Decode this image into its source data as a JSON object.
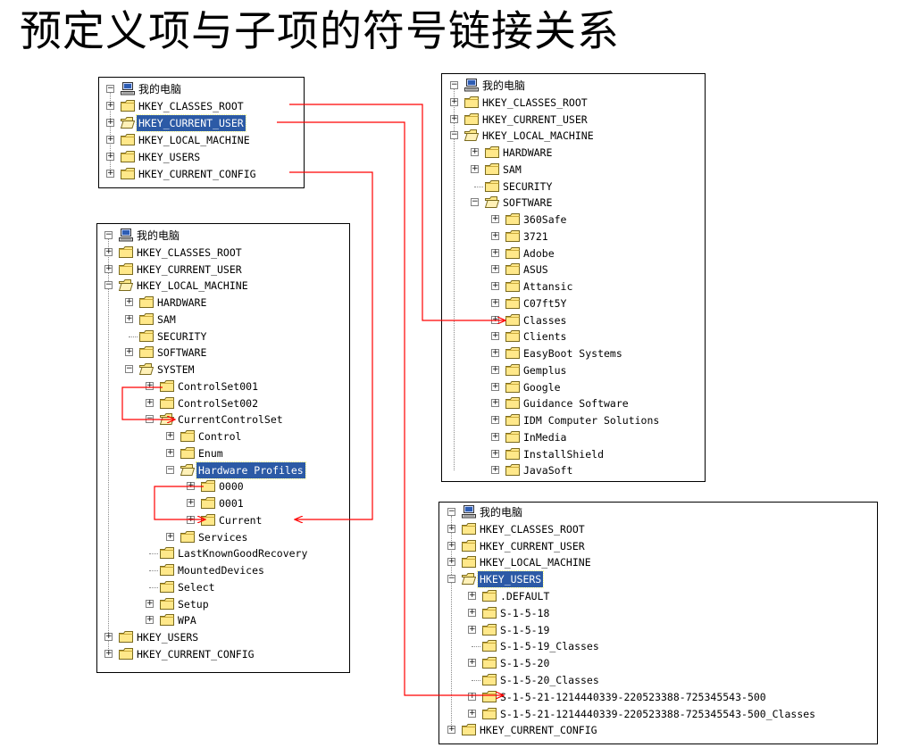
{
  "title": "预定义项与子项的符号链接关系",
  "colors": {
    "link_arrow": "#ff0000",
    "selection": "#2c5aa6"
  },
  "panels": {
    "a": {
      "root": "我的电脑",
      "items": [
        "HKEY_CLASSES_ROOT",
        "HKEY_CURRENT_USER",
        "HKEY_LOCAL_MACHINE",
        "HKEY_USERS",
        "HKEY_CURRENT_CONFIG"
      ]
    },
    "b": {
      "root": "我的电脑",
      "items": [
        "HKEY_CLASSES_ROOT",
        "HKEY_CURRENT_USER",
        "HKEY_LOCAL_MACHINE",
        "HARDWARE",
        "SAM",
        "SECURITY",
        "SOFTWARE",
        "SYSTEM",
        "ControlSet001",
        "ControlSet002",
        "CurrentControlSet",
        "Control",
        "Enum",
        "Hardware Profiles",
        "0000",
        "0001",
        "Current",
        "Services",
        "LastKnownGoodRecovery",
        "MountedDevices",
        "Select",
        "Setup",
        "WPA",
        "HKEY_USERS",
        "HKEY_CURRENT_CONFIG"
      ]
    },
    "c": {
      "root": "我的电脑",
      "items": [
        "HKEY_CLASSES_ROOT",
        "HKEY_CURRENT_USER",
        "HKEY_LOCAL_MACHINE",
        "HARDWARE",
        "SAM",
        "SECURITY",
        "SOFTWARE",
        "360Safe",
        "3721",
        "Adobe",
        "ASUS",
        "Attansic",
        "C07ft5Y",
        "Classes",
        "Clients",
        "EasyBoot Systems",
        "Gemplus",
        "Google",
        "Guidance Software",
        "IDM Computer Solutions",
        "InMedia",
        "InstallShield",
        "JavaSoft"
      ]
    },
    "d": {
      "root": "我的电脑",
      "items": [
        "HKEY_CLASSES_ROOT",
        "HKEY_CURRENT_USER",
        "HKEY_LOCAL_MACHINE",
        "HKEY_USERS",
        ".DEFAULT",
        "S-1-5-18",
        "S-1-5-19",
        "S-1-5-19_Classes",
        "S-1-5-20",
        "S-1-5-20_Classes",
        "S-1-5-21-1214440339-220523388-725345543-500",
        "S-1-5-21-1214440339-220523388-725345543-500_Classes",
        "HKEY_CURRENT_CONFIG"
      ]
    }
  }
}
